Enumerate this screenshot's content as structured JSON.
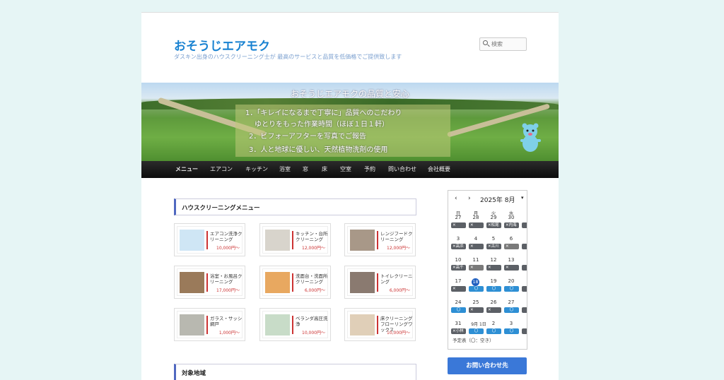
{
  "header": {
    "site_title": "おそうじエアモク",
    "site_description": "ダスキン出身のハウスクリーニング士が 最高のサービスと品質を低価格でご提供致します",
    "search_placeholder": "検索"
  },
  "banner": {
    "title": "おそうじエアモクの品質と安心",
    "lines": [
      "1．「キレイになるまで丁寧に」品質へのこだわり",
      "ゆとりをもった作業時間（ほぼ１日１軒）",
      "2．ビフォーアフターを写真でご報告",
      "3．人と地球に優しい、天然植物洗剤の使用"
    ]
  },
  "nav": [
    "メニュー",
    "エアコン",
    "キッチン",
    "浴室",
    "窓",
    "床",
    "空室",
    "予約",
    "問い合わせ",
    "会社概要"
  ],
  "menu_section": {
    "title": "ハウスクリーニングメニュー",
    "cards": [
      {
        "label": "エアコン洗浄クリーニング",
        "price": "10,000円〜",
        "thumb": "#cfe6f5"
      },
      {
        "label": "キッチン・台所クリーニング",
        "price": "12,000円〜",
        "thumb": "#d8d4cc"
      },
      {
        "label": "レンジフードクリーニング",
        "price": "12,000円〜",
        "thumb": "#a89888"
      },
      {
        "label": "浴室・お風呂クリーニング",
        "price": "17,000円〜",
        "thumb": "#9a7a5a"
      },
      {
        "label": "洗面台・洗面所クリーニング",
        "price": "6,000円〜",
        "thumb": "#e8a860"
      },
      {
        "label": "トイレクリーニング",
        "price": "6,000円〜",
        "thumb": "#8a7a70"
      },
      {
        "label": "ガラス・サッシ網戸",
        "price": "1,000円〜",
        "thumb": "#b8b8b0"
      },
      {
        "label": "ベランダ高圧洗浄",
        "price": "10,000円〜",
        "thumb": "#c8dcc8"
      },
      {
        "label": "床クリーニングフローリングワックス",
        "price": "10,000円〜",
        "thumb": "#e0cfb8"
      }
    ]
  },
  "area_section": {
    "title": "対象地域"
  },
  "calendar": {
    "prev": "‹",
    "next": "›",
    "month_label": "2025年 8月",
    "dropdown": "▾",
    "weekdays": [
      "日",
      "月",
      "火",
      "水"
    ],
    "weeks": [
      {
        "days": [
          "27",
          "28",
          "29",
          "30"
        ],
        "badges": [
          [
            "x",
            "✕"
          ],
          [
            "x",
            "✕"
          ],
          [
            "x",
            "✕松尾"
          ],
          [
            "x",
            "✕内海"
          ]
        ]
      },
      {
        "days": [
          "3",
          "4",
          "5",
          "6"
        ],
        "badges": [
          [
            "x",
            "✕高浜"
          ],
          [
            "x",
            "✕"
          ],
          [
            "x",
            "✕古川"
          ],
          [
            "y",
            "✕"
          ]
        ]
      },
      {
        "days": [
          "10",
          "11",
          "12",
          "13"
        ],
        "badges": [
          [
            "x",
            "✕高千"
          ],
          [
            "y",
            "✕"
          ],
          [
            "x",
            "✕"
          ],
          [
            "x",
            "✕"
          ]
        ]
      },
      {
        "days": [
          "17",
          "18",
          "19",
          "20"
        ],
        "badges": [
          [
            "x",
            "✕"
          ],
          [
            "o",
            "〇"
          ],
          [
            "o",
            "〇"
          ],
          [
            "o",
            "〇"
          ]
        ]
      },
      {
        "days": [
          "24",
          "25",
          "26",
          "27"
        ],
        "badges": [
          [
            "o",
            "〇"
          ],
          [
            "x",
            "✕"
          ],
          [
            "x",
            "✕"
          ],
          [
            "o",
            "〇"
          ]
        ]
      },
      {
        "days": [
          "31",
          "9月 1日",
          "2",
          "3"
        ],
        "badges": [
          [
            "x",
            "✕小林"
          ],
          [
            "o",
            "〇"
          ],
          [
            "o",
            "〇"
          ],
          [
            "o",
            "〇"
          ]
        ]
      }
    ],
    "today": "18",
    "legend": "予定表（〇：空き）"
  },
  "contact_button": "お問い合わせ先",
  "colors": {
    "accent": "#1982d1",
    "nav_bg": "#1a1a1a",
    "price_red": "#cc3333",
    "contact_blue": "#3a78d8"
  }
}
